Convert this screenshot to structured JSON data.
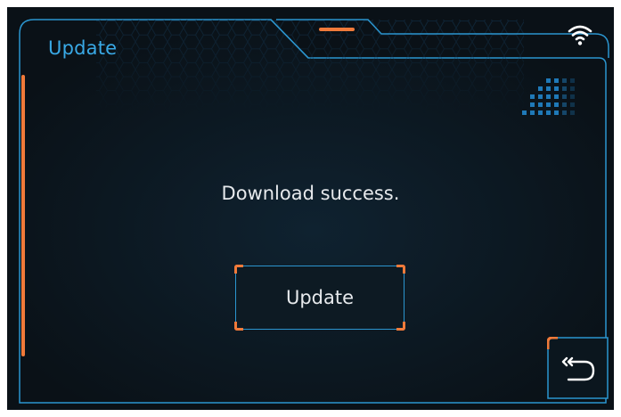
{
  "header": {
    "title": "Update"
  },
  "status": {
    "wifi_icon": "wifi-icon"
  },
  "dialog": {
    "message": "Download success.",
    "update_button_label": "Update"
  },
  "navigation": {
    "back_icon": "back-arrow-icon"
  },
  "colors": {
    "accent_blue": "#39a9e6",
    "accent_orange": "#f07a3a",
    "background": "#0a1117",
    "text": "#e6e9ec"
  }
}
